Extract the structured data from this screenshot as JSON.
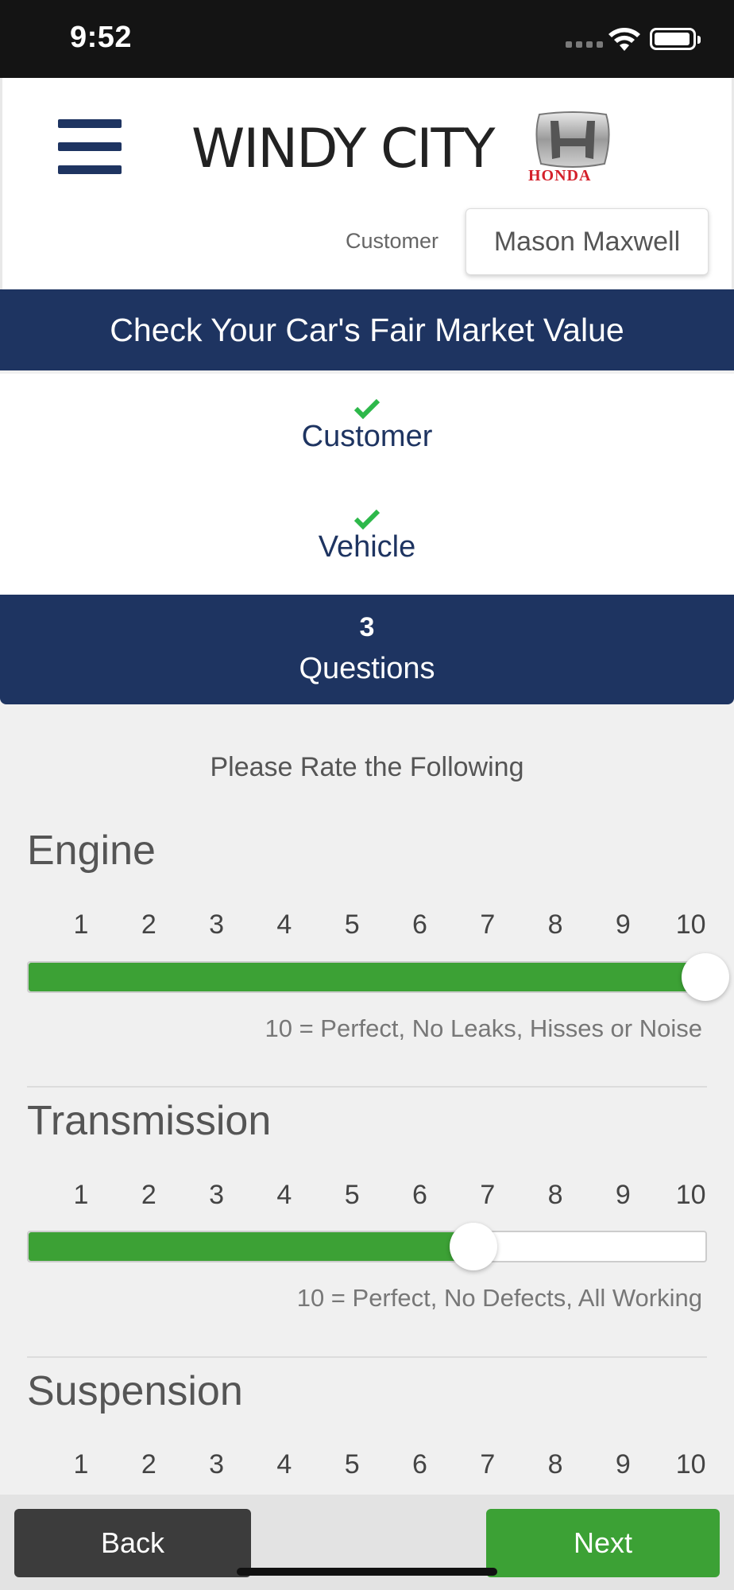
{
  "status_bar": {
    "time": "9:52"
  },
  "header": {
    "brand": "WINDY CITY",
    "honda_text": "HONDA",
    "customer_label": "Customer",
    "customer_name": "Mason Maxwell"
  },
  "title": "Check Your Car's Fair Market Value",
  "steps": [
    {
      "label": "Customer",
      "done": true
    },
    {
      "label": "Vehicle",
      "done": true
    }
  ],
  "current_step": {
    "number": "3",
    "label": "Questions"
  },
  "subtitle": "Please Rate the Following",
  "scale_labels": [
    "1",
    "2",
    "3",
    "4",
    "5",
    "6",
    "7",
    "8",
    "9",
    "10"
  ],
  "questions": [
    {
      "title": "Engine",
      "value": 10,
      "hint": "10 = Perfect, No Leaks, Hisses or Noise"
    },
    {
      "title": "Transmission",
      "value": 7,
      "hint": "10 = Perfect, No Defects, All Working"
    },
    {
      "title": "Suspension",
      "value": null,
      "hint": ""
    }
  ],
  "buttons": {
    "back": "Back",
    "next": "Next"
  },
  "colors": {
    "navy": "#1e3461",
    "green": "#3ca135",
    "honda_red": "#d4202a"
  }
}
